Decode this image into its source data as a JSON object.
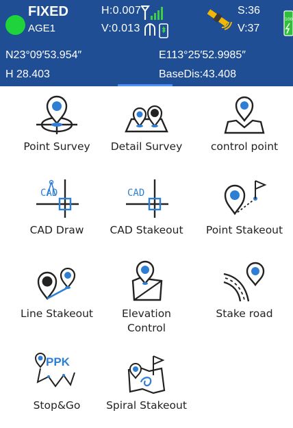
{
  "status": {
    "fix_status": "FIXED",
    "age": "AGE1",
    "h_precision": "H:0.007",
    "v_precision": "V:0.013",
    "satellites_used": "S:36",
    "satellites_visible": "V:37",
    "latitude": "N23°09′53.954″",
    "longitude": "E113°25′52.9985″",
    "height": "H 28.403",
    "base_distance": "BaseDis:43.408",
    "battery_level": "100",
    "colors": {
      "header_bg": "#1f4e95",
      "fix_indicator": "#1ed43a",
      "accent": "#2e7fd3"
    },
    "icons": [
      "signal-icon",
      "radio-icon",
      "phone-icon",
      "satellite-icon",
      "battery-icon"
    ]
  },
  "functions": [
    {
      "label": "Point Survey",
      "icon": "point-survey-icon"
    },
    {
      "label": "Detail Survey",
      "icon": "detail-survey-icon"
    },
    {
      "label": "control point",
      "icon": "control-point-icon"
    },
    {
      "label": "CAD Draw",
      "icon": "cad-draw-icon"
    },
    {
      "label": "CAD Stakeout",
      "icon": "cad-stakeout-icon"
    },
    {
      "label": "Point Stakeout",
      "icon": "point-stakeout-icon"
    },
    {
      "label": "Line Stakeout",
      "icon": "line-stakeout-icon"
    },
    {
      "label": "Elevation\nControl",
      "icon": "elevation-control-icon"
    },
    {
      "label": "Stake road",
      "icon": "stake-road-icon"
    },
    {
      "label": "Stop&Go",
      "icon": "stop-and-go-icon"
    },
    {
      "label": "Spiral Stakeout",
      "icon": "spiral-stakeout-icon"
    }
  ],
  "icon_text": {
    "cad_draw_text": "CAD",
    "cad_stakeout_text": "CAD",
    "ppk_text": "PPK"
  }
}
